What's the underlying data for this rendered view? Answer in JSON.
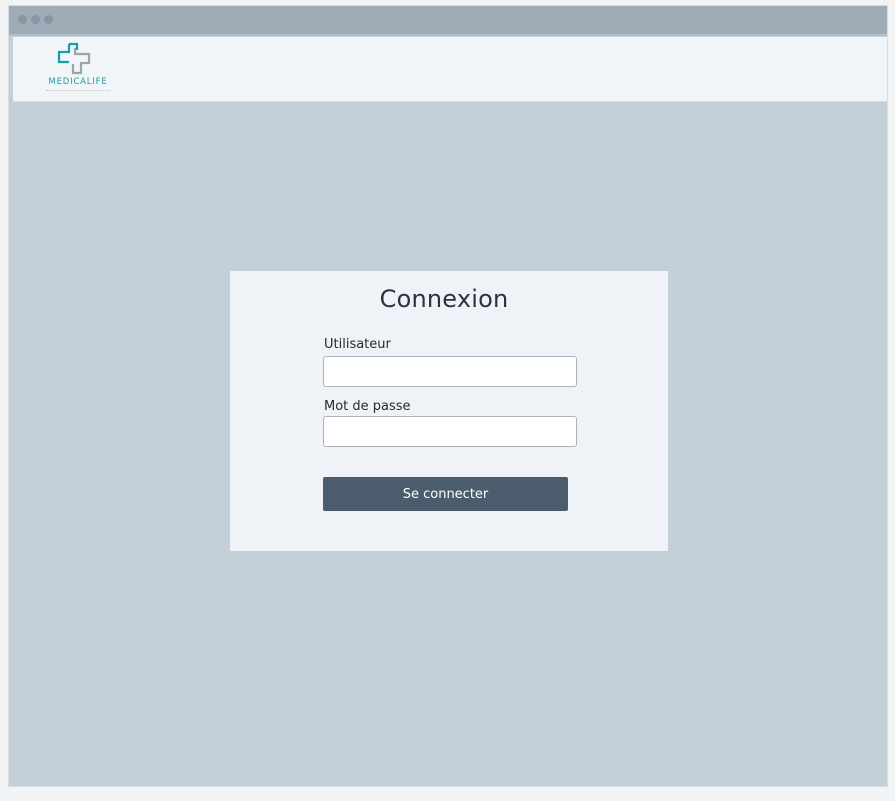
{
  "brand": {
    "name": "MEDICALIFE",
    "accent_color": "#179ea6",
    "secondary_color": "#9aa6ae"
  },
  "login": {
    "title": "Connexion",
    "username_label": "Utilisateur",
    "username_value": "",
    "password_label": "Mot de passe",
    "password_value": "",
    "submit_label": "Se connecter"
  },
  "colors": {
    "background": "#c4d0d8",
    "button": "#4b5d6c",
    "card": "#eff3f7"
  }
}
